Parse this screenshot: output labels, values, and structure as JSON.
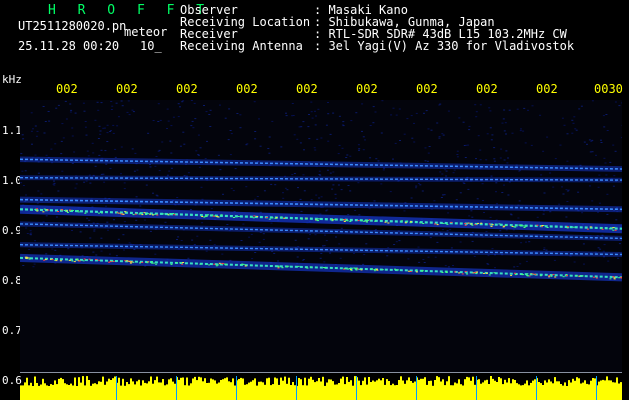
{
  "header": {
    "app_title": "H R O F F T",
    "filename": "UT2511280020.pn",
    "mode": "meteor",
    "datetime": "25.11.28 00:20",
    "datetime_suffix": "10_",
    "info": [
      {
        "label": "Observer",
        "value": ": Masaki Kano"
      },
      {
        "label": "Receiving Location",
        "value": ": Shibukawa, Gunma, Japan"
      },
      {
        "label": "Receiver",
        "value": ": RTL-SDR SDR# 43dB L15 103.2MHz CW"
      },
      {
        "label": "Receiving Antenna",
        "value": ": 3el Yagi(V) Az 330 for Vladivostok"
      }
    ]
  },
  "axis": {
    "unit": "kHz",
    "y_ticks": [
      {
        "label": "1.1",
        "value": 1.1
      },
      {
        "label": "1.0",
        "value": 1.0
      },
      {
        "label": "0.9",
        "value": 0.9
      },
      {
        "label": "0.8",
        "value": 0.8
      },
      {
        "label": "0.7",
        "value": 0.7
      },
      {
        "label": "0.6",
        "value": 0.6
      }
    ],
    "x_ticks": [
      "002",
      "002",
      "002",
      "002",
      "002",
      "002",
      "002",
      "002",
      "002",
      "0030"
    ]
  },
  "spectrogram": {
    "y_range": [
      0.6,
      1.16
    ],
    "traces": [
      {
        "start": 1.038,
        "end": 1.018,
        "strength": 0.45
      },
      {
        "start": 1.0,
        "end": 0.995,
        "strength": 0.3
      },
      {
        "start": 0.955,
        "end": 0.935,
        "strength": 0.5
      },
      {
        "start": 0.935,
        "end": 0.895,
        "strength": 1.0
      },
      {
        "start": 0.905,
        "end": 0.875,
        "strength": 0.35
      },
      {
        "start": 0.862,
        "end": 0.842,
        "strength": 0.35
      },
      {
        "start": 0.835,
        "end": 0.795,
        "strength": 0.85
      }
    ]
  },
  "colors": {
    "background": "#000000",
    "title": "#00ff66",
    "text": "#ffffff",
    "tick": "#ffff00",
    "histogram": "#ffff00"
  }
}
